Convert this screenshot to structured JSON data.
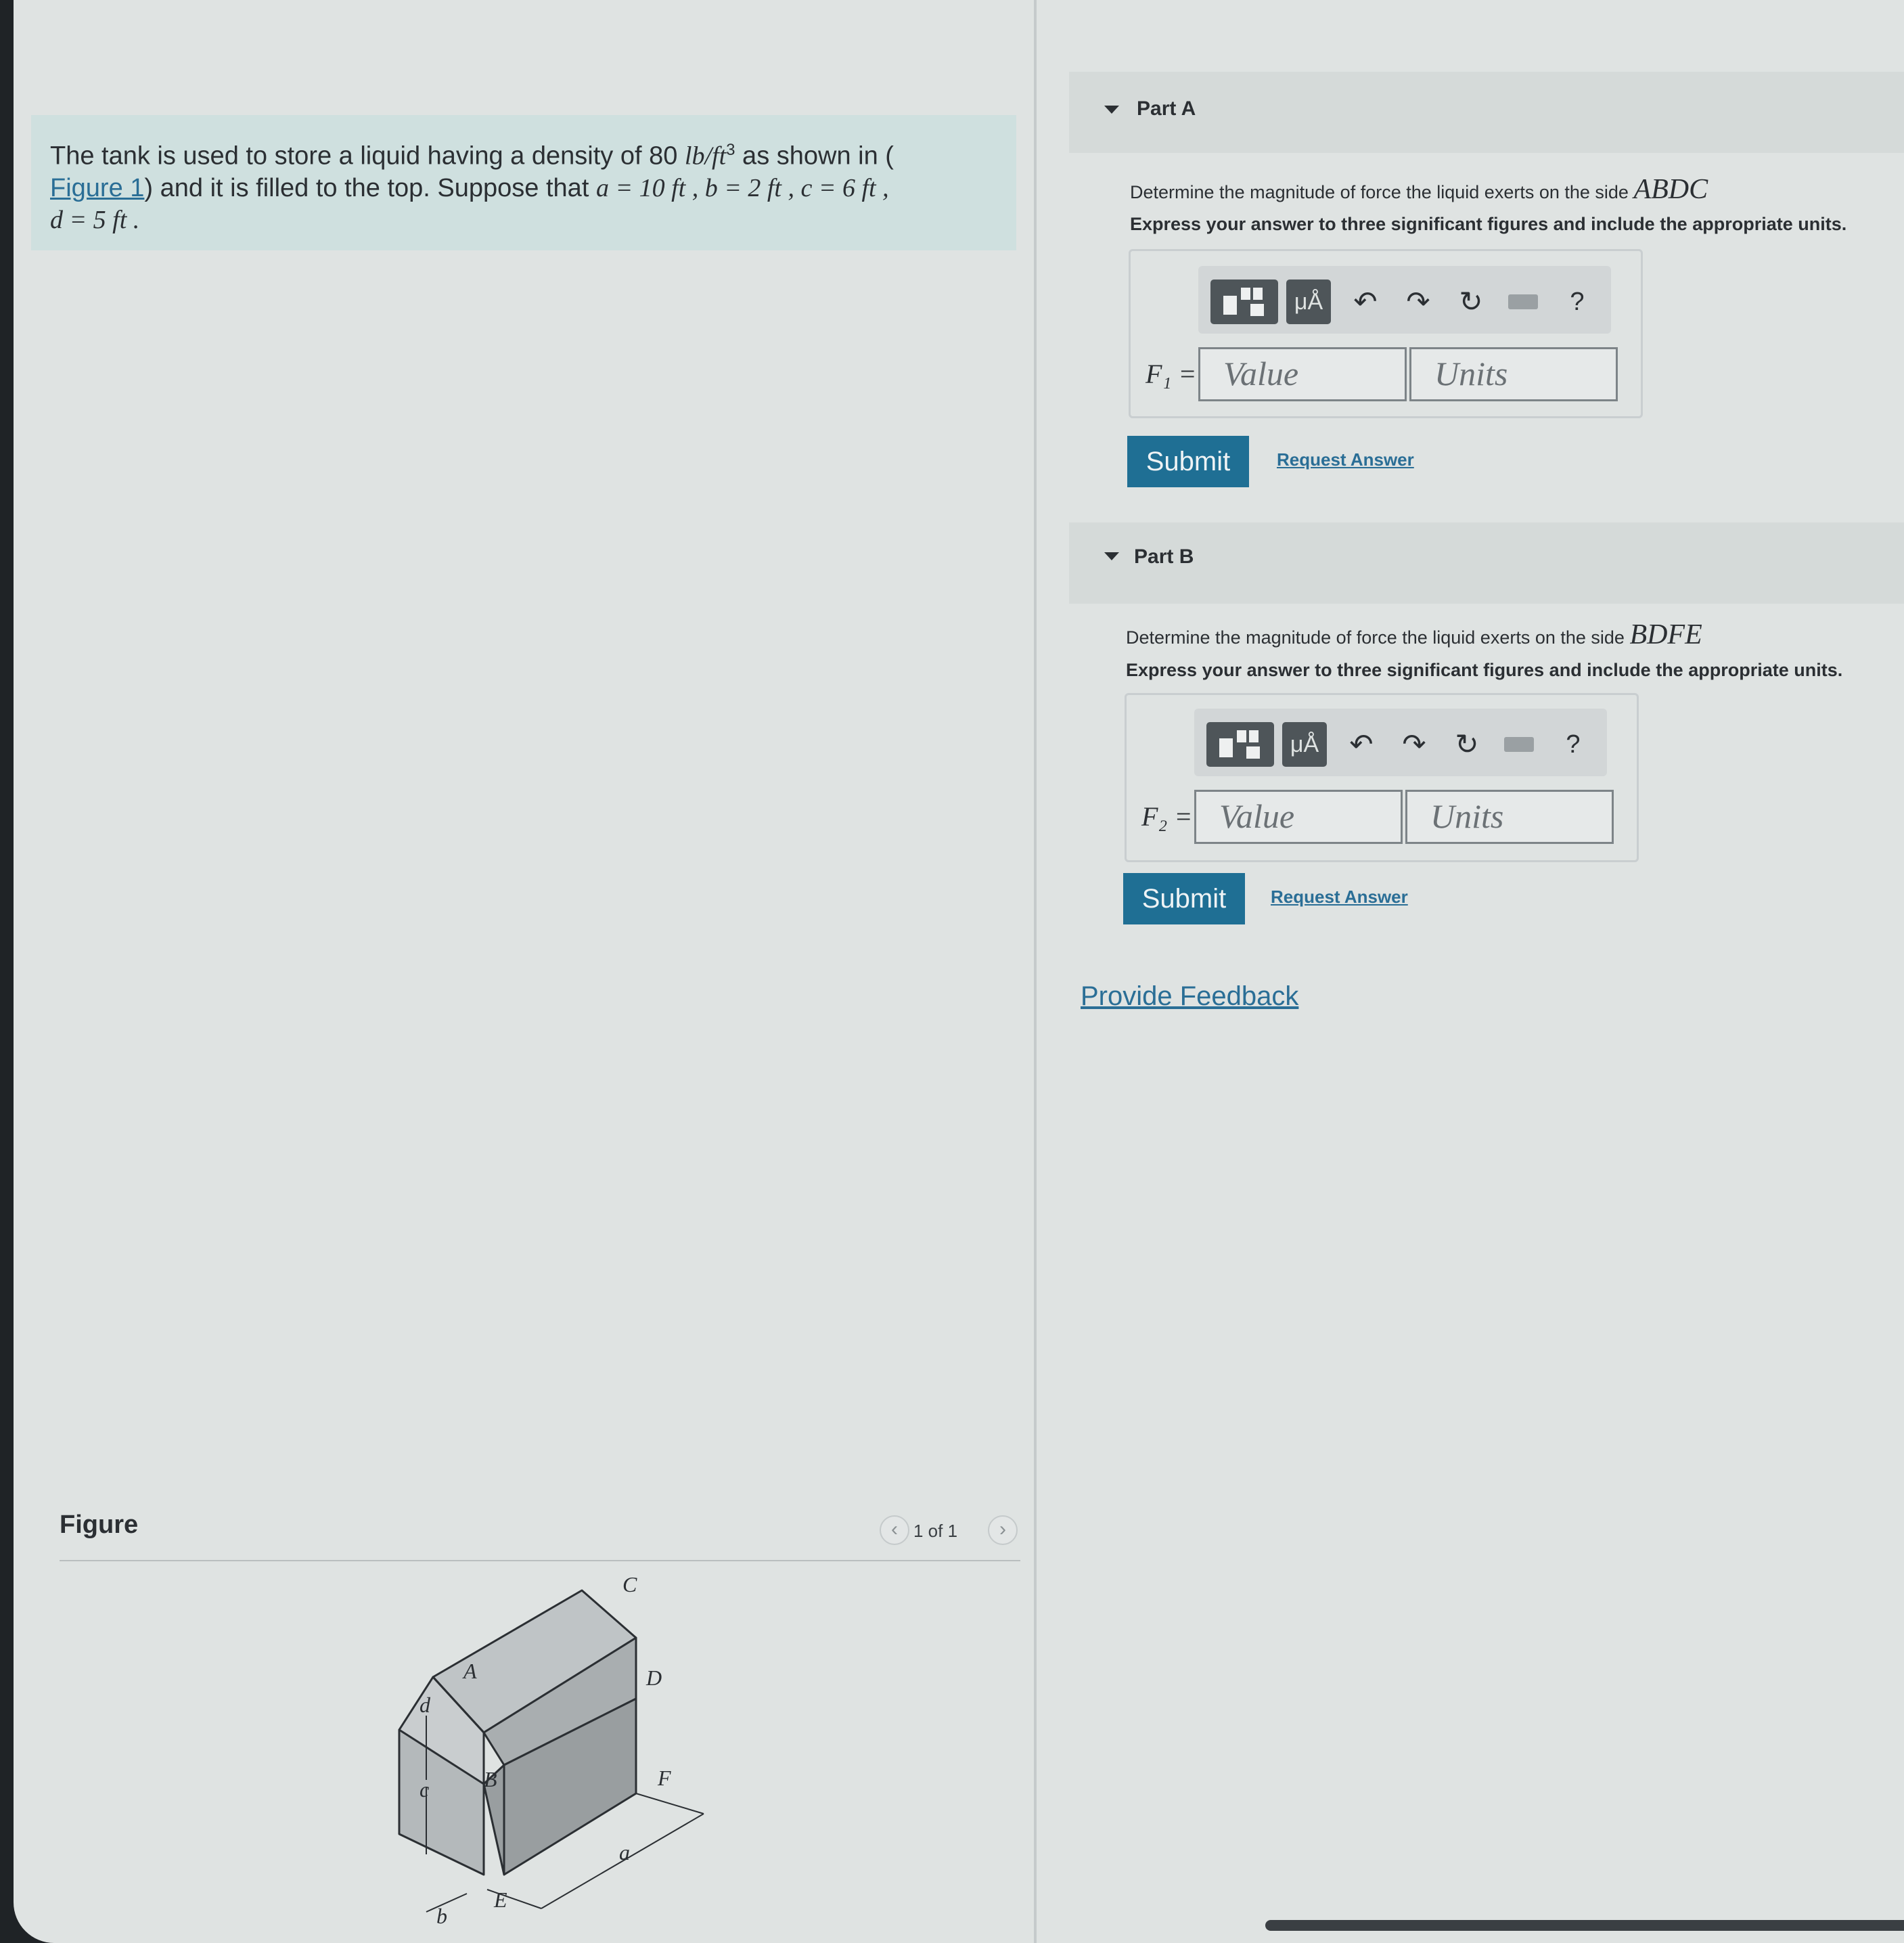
{
  "problem": {
    "part1": "The tank is used to store a liquid having a density of 80 ",
    "density_unit": "lb/ft",
    "exp": "3",
    "part2": " as shown in (",
    "figure_link": "Figure 1",
    "part3": ") and it is filled to the top. Suppose that ",
    "a_eq": "a = 10 ft , b = 2 ft , c = 6 ft ,",
    "d_eq": "d = 5 ft ."
  },
  "figure": {
    "title": "Figure",
    "pager": "1 of 1",
    "prev": "‹",
    "next": "›",
    "labels": {
      "A": "A",
      "B": "B",
      "C": "C",
      "D": "D",
      "E": "E",
      "F": "F",
      "a": "a",
      "b": "b",
      "c": "c",
      "d": "d"
    }
  },
  "partA": {
    "label": "Part A",
    "question": "Determine the magnitude of force the liquid exerts on the side ",
    "side": "ABDC",
    "instruction": "Express your answer to three significant figures and include the appropriate units.",
    "eq_label": "F₁ =",
    "value_placeholder": "Value",
    "units_placeholder": "Units",
    "submit": "Submit",
    "request": "Request Answer"
  },
  "partB": {
    "label": "Part B",
    "question": "Determine the magnitude of force the liquid exerts on the side ",
    "side": "BDFE",
    "instruction": "Express your answer to three significant figures and include the appropriate units.",
    "eq_label": "F₂ =",
    "value_placeholder": "Value",
    "units_placeholder": "Units",
    "submit": "Submit",
    "request": "Request Answer"
  },
  "toolbar": {
    "mu_label": "μÅ",
    "help": "?",
    "icons": [
      "templates-icon",
      "units-icon",
      "undo-icon",
      "redo-icon",
      "reset-icon",
      "keyboard-icon",
      "help-icon"
    ]
  },
  "feedback": "Provide Feedback"
}
